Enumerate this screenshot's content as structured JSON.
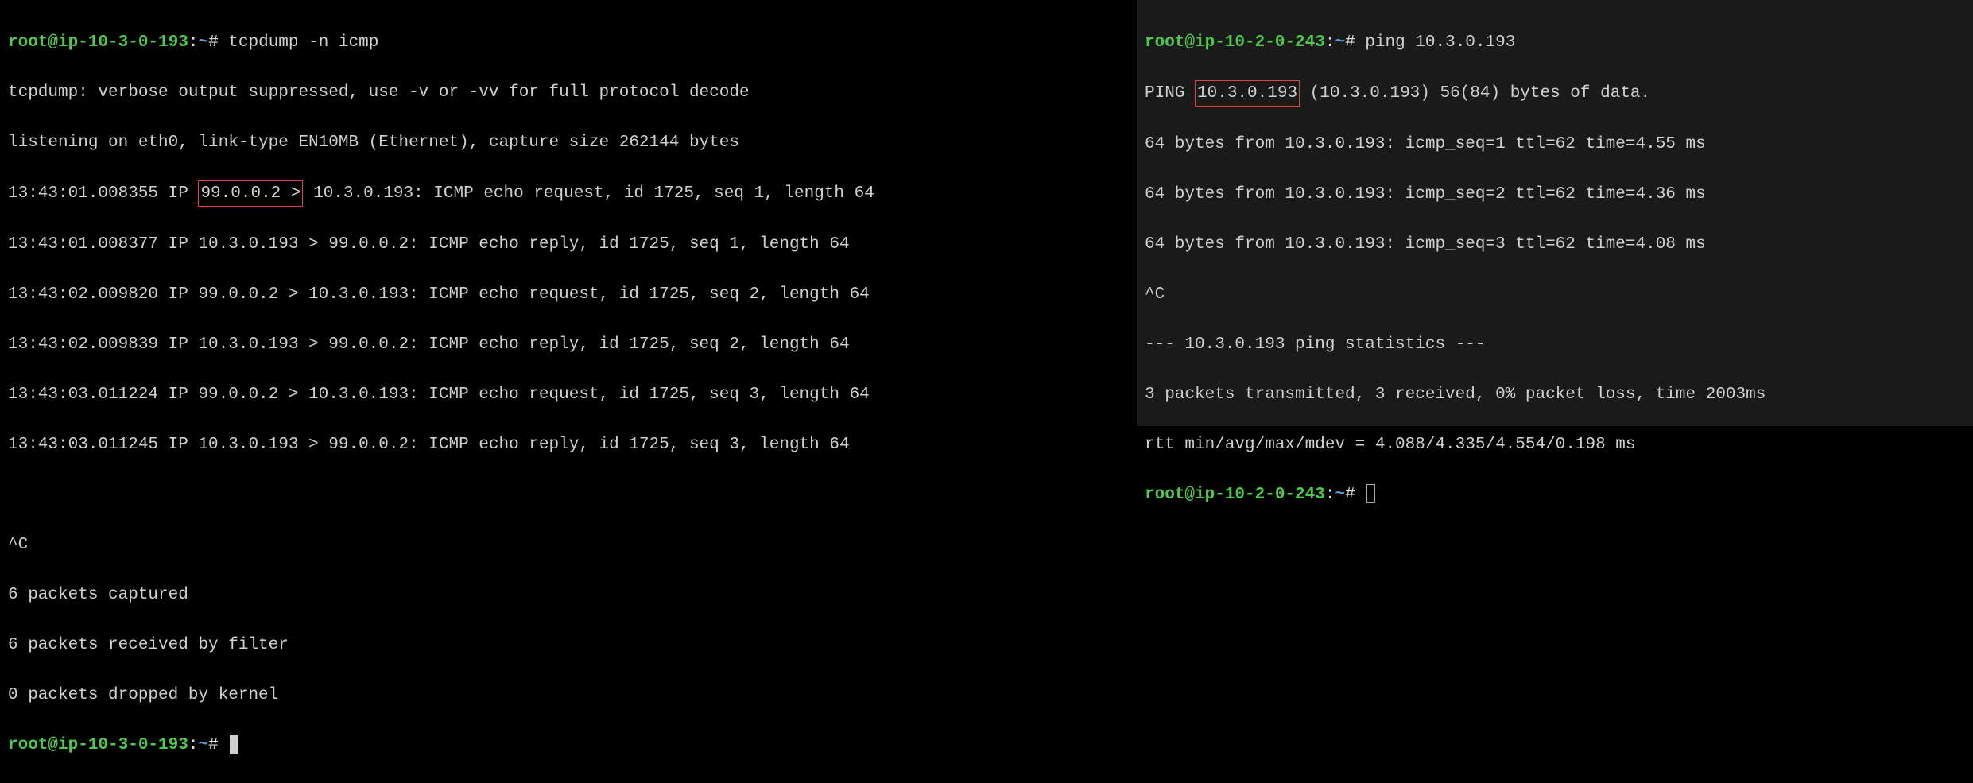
{
  "left": {
    "prompt": {
      "user": "root@ip-10-3-0-193",
      "path": "~",
      "cmd": "tcpdump -n icmp"
    },
    "lines": {
      "l1": "tcpdump: verbose output suppressed, use -v or -vv for full protocol decode",
      "l2": "listening on eth0, link-type EN10MB (Ethernet), capture size 262144 bytes",
      "l3a": "13:43:01.008355 IP ",
      "l3_hl": "99.0.0.2 >",
      "l3b": " 10.3.0.193: ICMP echo request, id 1725, seq 1, length 64",
      "l4": "13:43:01.008377 IP 10.3.0.193 > 99.0.0.2: ICMP echo reply, id 1725, seq 1, length 64",
      "l5": "13:43:02.009820 IP 99.0.0.2 > 10.3.0.193: ICMP echo request, id 1725, seq 2, length 64",
      "l6": "13:43:02.009839 IP 10.3.0.193 > 99.0.0.2: ICMP echo reply, id 1725, seq 2, length 64",
      "l7": "13:43:03.011224 IP 99.0.0.2 > 10.3.0.193: ICMP echo request, id 1725, seq 3, length 64",
      "l8": "13:43:03.011245 IP 10.3.0.193 > 99.0.0.2: ICMP echo reply, id 1725, seq 3, length 64",
      "lc": "^C",
      "s1": "6 packets captured",
      "s2": "6 packets received by filter",
      "s3": "0 packets dropped by kernel"
    },
    "prompt2": {
      "user": "root@ip-10-3-0-193",
      "path": "~"
    }
  },
  "right": {
    "prompt": {
      "user": "root@ip-10-2-0-243",
      "path": "~",
      "cmd": "ping 10.3.0.193"
    },
    "lines": {
      "l1a": "PING ",
      "l1_hl": "10.3.0.193",
      "l1b": " (10.3.0.193) 56(84) bytes of data.",
      "l2": "64 bytes from 10.3.0.193: icmp_seq=1 ttl=62 time=4.55 ms",
      "l3": "64 bytes from 10.3.0.193: icmp_seq=2 ttl=62 time=4.36 ms",
      "l4": "64 bytes from 10.3.0.193: icmp_seq=3 ttl=62 time=4.08 ms",
      "lc": "^C",
      "s1": "--- 10.3.0.193 ping statistics ---",
      "s2": "3 packets transmitted, 3 received, 0% packet loss, time 2003ms",
      "s3": "rtt min/avg/max/mdev = 4.088/4.335/4.554/0.198 ms"
    },
    "prompt2": {
      "user": "root@ip-10-2-0-243",
      "path": "~"
    }
  }
}
